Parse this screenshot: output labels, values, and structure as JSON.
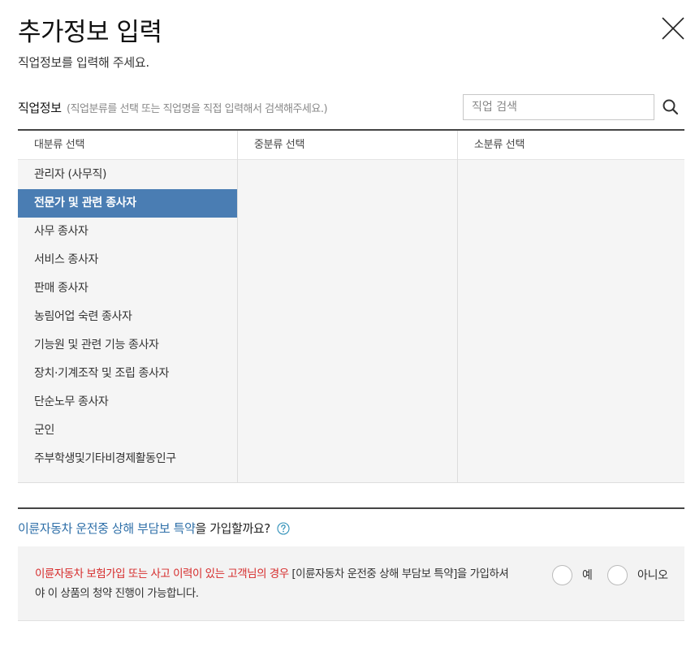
{
  "header": {
    "title": "추가정보 입력",
    "subtitle": "직업정보를 입력해 주세요."
  },
  "icons": {
    "close": "close-icon",
    "search": "search-icon",
    "help": "question-circle-icon"
  },
  "job_section": {
    "label": "직업정보",
    "hint": "(직업분류를 선택 또는 직업명을 직접 입력해서 검색해주세요.)",
    "search_placeholder": "직업 검색",
    "search_value": ""
  },
  "columns": {
    "major_header": "대분류 선택",
    "middle_header": "중분류 선택",
    "minor_header": "소분류 선택",
    "major_items": [
      "관리자 (사무직)",
      "전문가 및 관련 종사자",
      "사무 종사자",
      "서비스 종사자",
      "판매 종사자",
      "농림어업 숙련 종사자",
      "기능원 및 관련 기능 종사자",
      "장치·기계조작 및 조립 종사자",
      "단순노무 종사자",
      "군인",
      "주부학생및기타비경제활동인구"
    ],
    "selected_major_index": 1
  },
  "rider": {
    "question_highlight": "이륜자동차 운전중 상해 부담보 특약",
    "question_rest": "을 가입할까요?",
    "notice_red": "이륜자동차 보험가입 또는 사고 이력이 있는 고객님의 경우",
    "notice_rest": " [이륜자동차 운전중 상해 부담보 특약]을 가입하셔야 이 상품의 청약 진행이 가능합니다.",
    "option_yes": "예",
    "option_no": "아니오"
  },
  "colors": {
    "selected_bg": "#4a7db3",
    "highlight_text": "#2e6fa8",
    "warning_text": "#d62b2b",
    "column_bg": "#f5f5f5"
  }
}
